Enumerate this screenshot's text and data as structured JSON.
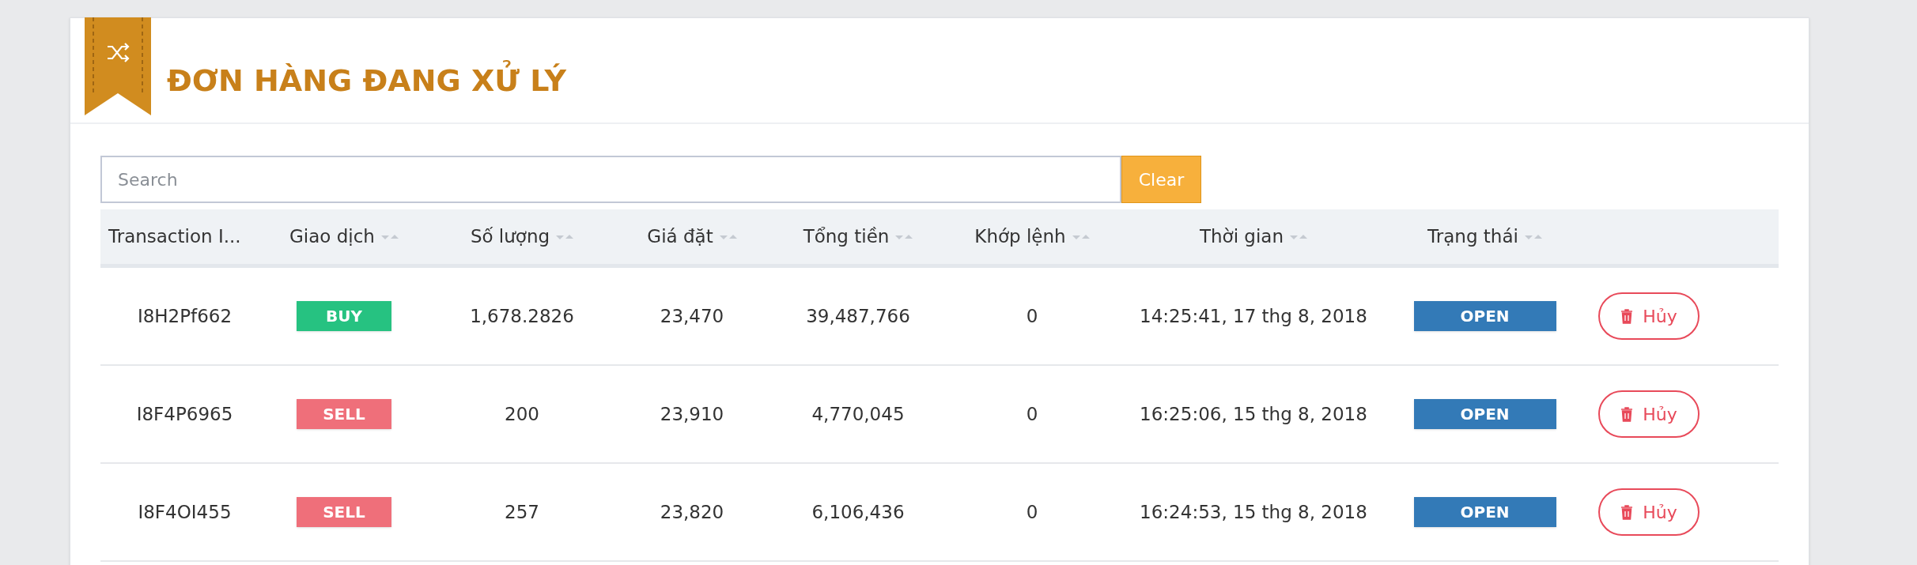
{
  "header": {
    "title": "ĐƠN HÀNG ĐANG XỬ LÝ"
  },
  "search": {
    "placeholder": "Search",
    "button": "Clear"
  },
  "table": {
    "columns": [
      {
        "label": "Transaction I...",
        "sortable": false
      },
      {
        "label": "Giao dịch",
        "sortable": true
      },
      {
        "label": "Số lượng",
        "sortable": true
      },
      {
        "label": "Giá đặt",
        "sortable": true
      },
      {
        "label": "Tổng tiền",
        "sortable": true
      },
      {
        "label": "Khớp lệnh",
        "sortable": true
      },
      {
        "label": "Thời gian",
        "sortable": true
      },
      {
        "label": "Trạng thái",
        "sortable": true
      }
    ],
    "rows": [
      {
        "id": "I8H2Pf662",
        "side": {
          "label": "BUY",
          "kind": "buy"
        },
        "quantity": "1,678.2826",
        "price": "23,470",
        "total": "39,487,766",
        "matched": "0",
        "time": "14:25:41, 17 thg 8, 2018",
        "status": "OPEN",
        "action": "Hủy"
      },
      {
        "id": "I8F4P6965",
        "side": {
          "label": "SELL",
          "kind": "sell"
        },
        "quantity": "200",
        "price": "23,910",
        "total": "4,770,045",
        "matched": "0",
        "time": "16:25:06, 15 thg 8, 2018",
        "status": "OPEN",
        "action": "Hủy"
      },
      {
        "id": "I8F4OI455",
        "side": {
          "label": "SELL",
          "kind": "sell"
        },
        "quantity": "257",
        "price": "23,820",
        "total": "6,106,436",
        "matched": "0",
        "time": "16:24:53, 15 thg 8, 2018",
        "status": "OPEN",
        "action": "Hủy"
      }
    ]
  }
}
